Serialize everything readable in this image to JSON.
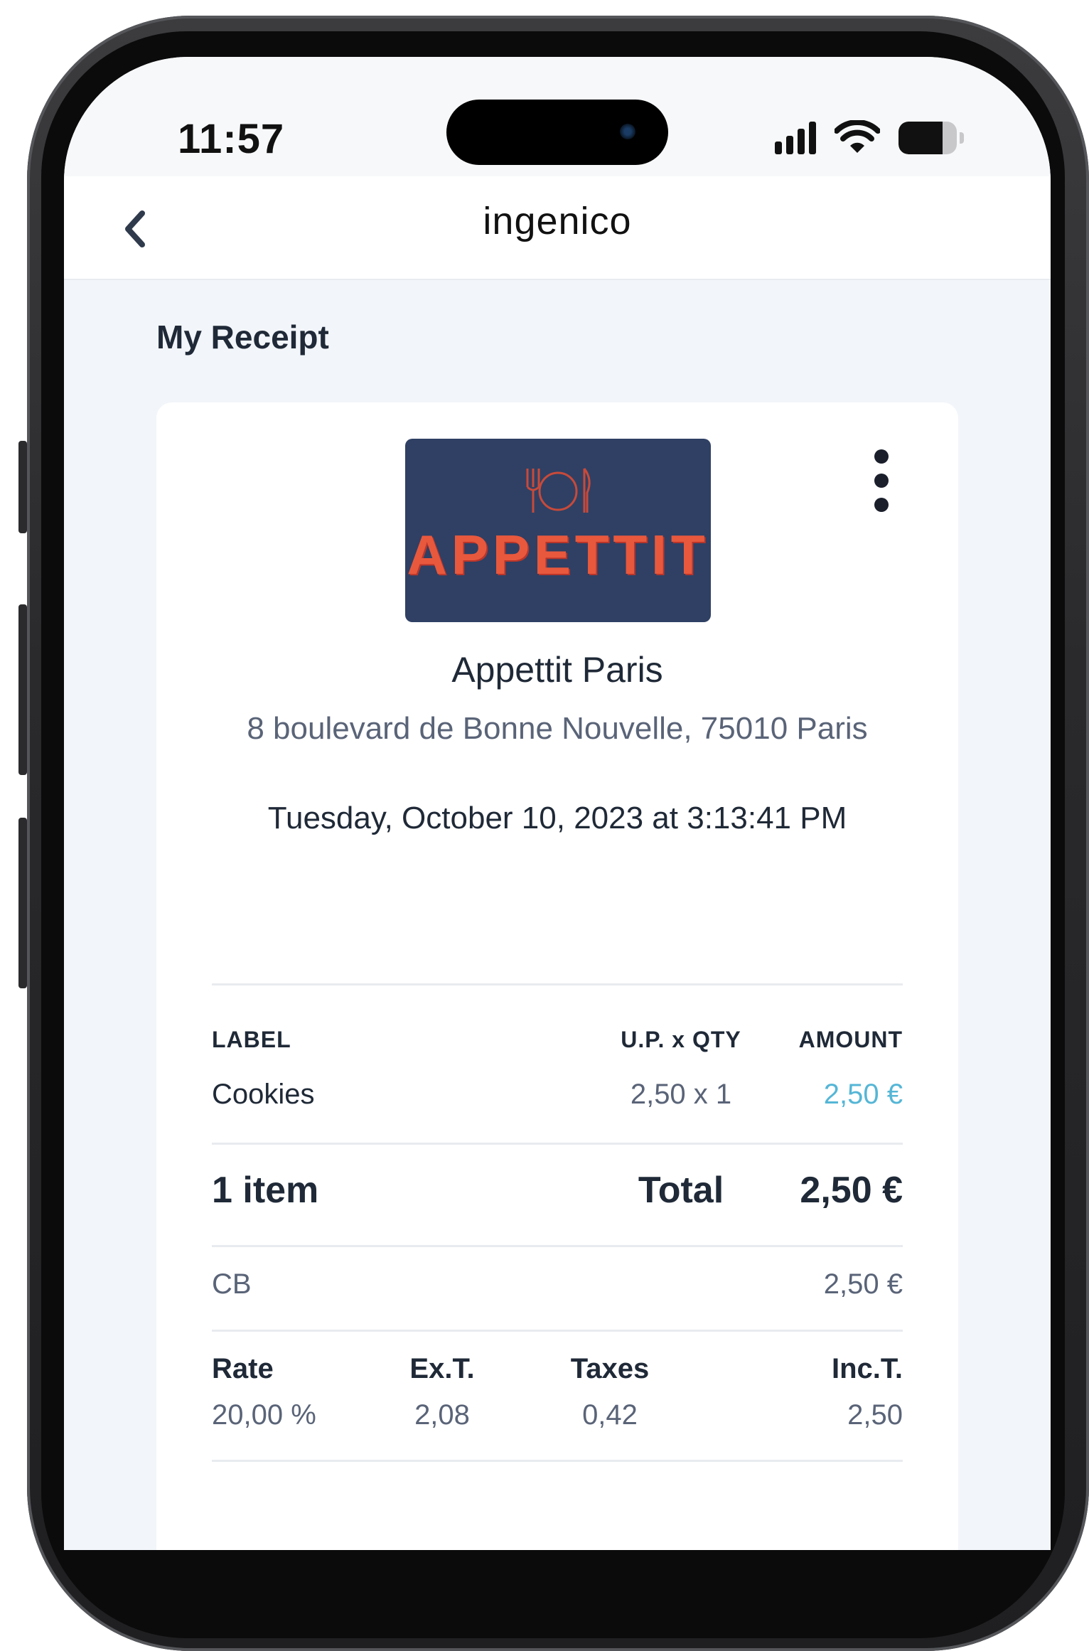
{
  "status_bar": {
    "time": "11:57",
    "battery_level": 0.75
  },
  "nav": {
    "brand": "ingenico",
    "back_icon": "chevron-left-icon"
  },
  "page": {
    "title": "My Receipt"
  },
  "receipt": {
    "logo_text": "APPETTIT",
    "logo_icon": "fork-plate-knife-icon",
    "more_icon": "more-vertical-icon",
    "merchant_name": "Appettit Paris",
    "merchant_address": "8 boulevard de Bonne Nouvelle, 75010 Paris",
    "date": "Tuesday, October 10, 2023 at 3:13:41 PM",
    "columns": {
      "label": "LABEL",
      "up_qty": "U.P. x QTY",
      "amount": "AMOUNT"
    },
    "items": [
      {
        "label": "Cookies",
        "up_qty": "2,50 x 1",
        "amount": "2,50 €"
      }
    ],
    "summary": {
      "count": "1 item",
      "total_label": "Total",
      "total_amount": "2,50 €"
    },
    "payment": {
      "method": "CB",
      "amount": "2,50 €"
    },
    "tax": {
      "headers": {
        "rate": "Rate",
        "ext": "Ex.T.",
        "taxes": "Taxes",
        "inct": "Inc.T."
      },
      "values": {
        "rate": "20,00 %",
        "ext": "2,08",
        "taxes": "0,42",
        "inct": "2,50"
      }
    }
  },
  "colors": {
    "accent": "#55b6d6",
    "logo_bg": "#2f4064",
    "logo_text": "#e8583d"
  }
}
